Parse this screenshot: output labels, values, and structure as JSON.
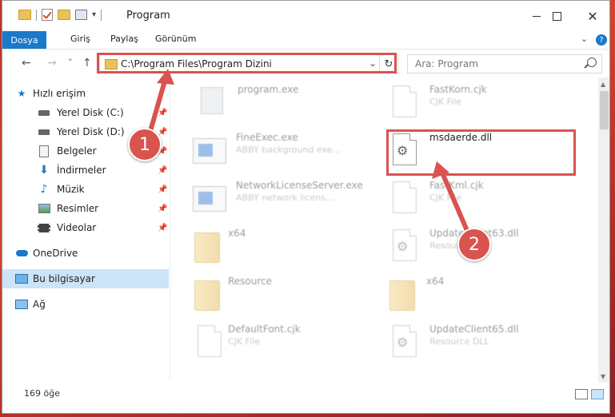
{
  "window": {
    "title": "Program"
  },
  "menu": {
    "file": "Dosya",
    "home": "Giriş",
    "share": "Paylaş",
    "view": "Görünüm",
    "help": "?"
  },
  "nav": {
    "back": "←",
    "forward": "→",
    "recent": "˅",
    "up": "↑"
  },
  "address": {
    "path": "C:\\Program Files\\Program Dizini",
    "chevron": "⌄",
    "refresh": "↻"
  },
  "search": {
    "placeholder": "Ara: Program"
  },
  "sidebar": {
    "items": [
      {
        "label": "Hızlı erişim",
        "icon": "star-icon"
      },
      {
        "label": "Yerel Disk (C:)",
        "icon": "drive-icon"
      },
      {
        "label": "Yerel Disk (D:)",
        "icon": "drive-icon"
      },
      {
        "label": "Belgeler",
        "icon": "documents-icon"
      },
      {
        "label": "İndirmeler",
        "icon": "download-icon"
      },
      {
        "label": "Müzik",
        "icon": "music-icon"
      },
      {
        "label": "Resimler",
        "icon": "pictures-icon"
      },
      {
        "label": "Videolar",
        "icon": "video-icon"
      },
      {
        "label": "OneDrive",
        "icon": "cloud-icon"
      },
      {
        "label": "Bu bilgisayar",
        "icon": "computer-icon"
      },
      {
        "label": "Ağ",
        "icon": "network-icon"
      }
    ]
  },
  "files": [
    {
      "name": "program.exe",
      "desc": "",
      "type": "program"
    },
    {
      "name": "FastKorn.cjk",
      "desc": "CJK File",
      "type": "doc"
    },
    {
      "name": "FineExec.exe",
      "desc": "ABBY background exe...",
      "type": "exe"
    },
    {
      "name": "msdaerde.dll",
      "desc": "",
      "type": "dll"
    },
    {
      "name": "NetworkLicenseServer.exe",
      "desc": "ABBY network licens...",
      "type": "exe"
    },
    {
      "name": "FastKml.cjk",
      "desc": "CJK File",
      "type": "doc"
    },
    {
      "name": "x64",
      "desc": "",
      "type": "folder"
    },
    {
      "name": "UpdateClient63.dll",
      "desc": "Resource DLL",
      "type": "dll"
    },
    {
      "name": "Resource",
      "desc": "",
      "type": "folder"
    },
    {
      "name": "x64",
      "desc": "",
      "type": "folder"
    },
    {
      "name": "DefaultFont.cjk",
      "desc": "CJK File",
      "type": "doc"
    },
    {
      "name": "UpdateClient65.dll",
      "desc": "Resource DLL",
      "type": "dll"
    }
  ],
  "status": {
    "count": "169 öğe"
  },
  "annotations": {
    "badge1": "1",
    "badge2": "2"
  },
  "colors": {
    "accent": "#1979ca",
    "highlight": "#d9534f"
  }
}
